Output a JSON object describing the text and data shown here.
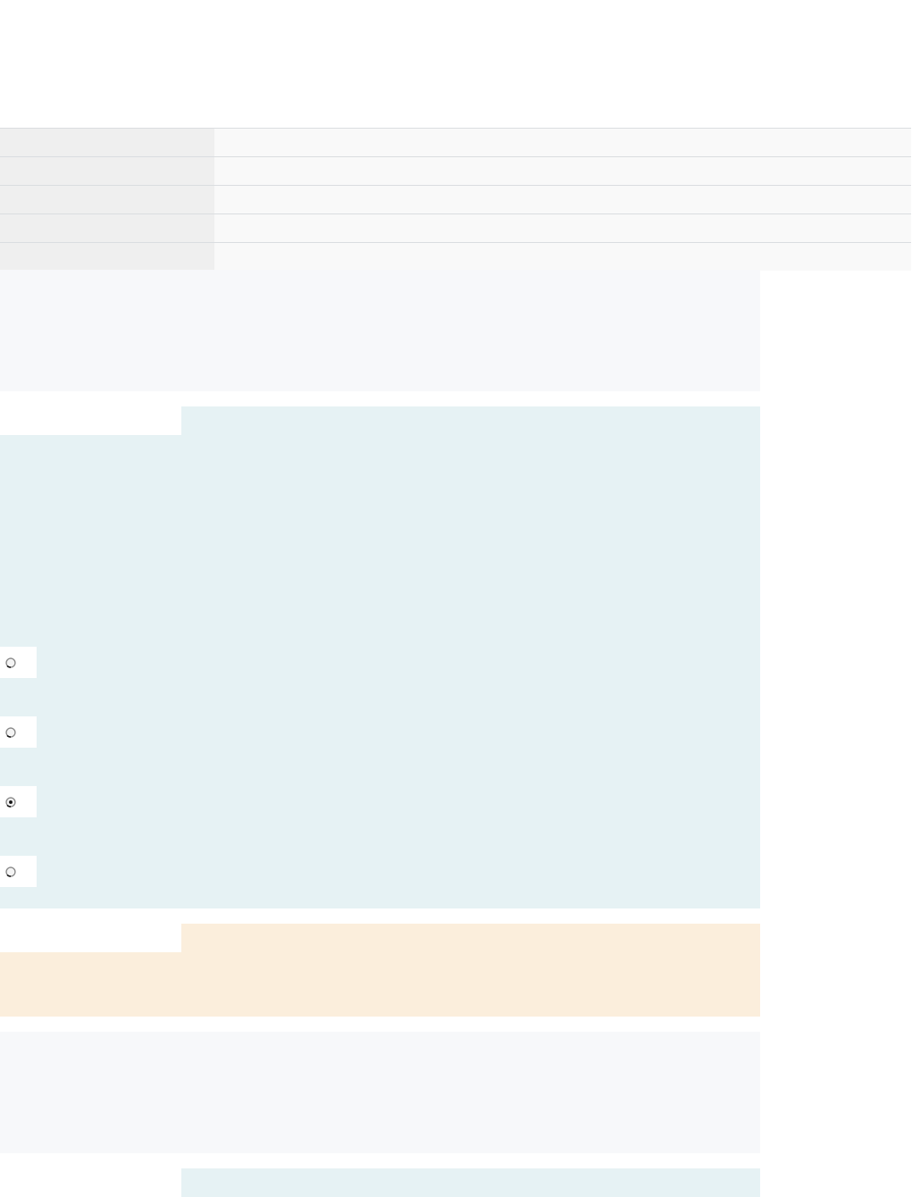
{
  "table": {
    "rows": [
      {
        "kind": "blank"
      },
      {
        "kind": "blank"
      },
      {
        "kind": "blank"
      },
      {
        "kind": "blank"
      },
      {
        "kind": "blank"
      }
    ]
  },
  "panels": [
    {
      "kind": "plain",
      "color": "#f7f8fa"
    },
    {
      "kind": "tabbed",
      "color": "#e6f2f4",
      "radio_options": [
        {
          "selected": false
        },
        {
          "selected": false
        },
        {
          "selected": true
        },
        {
          "selected": false
        }
      ]
    },
    {
      "kind": "tabbed",
      "color": "#fbeedc"
    },
    {
      "kind": "plain",
      "color": "#f7f8fa"
    },
    {
      "kind": "tabbed",
      "color": "#e6f2f4"
    }
  ]
}
